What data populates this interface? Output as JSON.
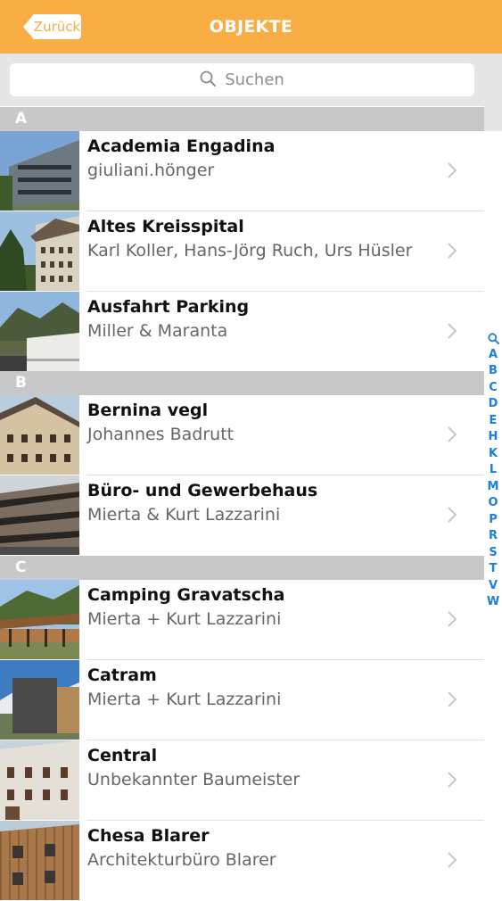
{
  "nav": {
    "back_label": "Zurück",
    "title": "OBJEKTE"
  },
  "search": {
    "placeholder": "Suchen"
  },
  "sections": [
    {
      "letter": "A",
      "items": [
        {
          "title": "Academia Engadina",
          "subtitle": "giuliani.hönger"
        },
        {
          "title": "Altes Kreisspital",
          "subtitle": "Karl Koller, Hans-Jörg Ruch, Urs Hüsler"
        },
        {
          "title": "Ausfahrt Parking",
          "subtitle": "Miller & Maranta"
        }
      ]
    },
    {
      "letter": "B",
      "items": [
        {
          "title": "Bernina vegl",
          "subtitle": "Johannes Badrutt"
        },
        {
          "title": "Büro- und Gewerbehaus",
          "subtitle": "Mierta & Kurt Lazzarini"
        }
      ]
    },
    {
      "letter": "C",
      "items": [
        {
          "title": "Camping Gravatscha",
          "subtitle": "Mierta + Kurt Lazzarini"
        },
        {
          "title": "Catram",
          "subtitle": "Mierta + Kurt Lazzarini"
        },
        {
          "title": "Central",
          "subtitle": "Unbekannter Baumeister"
        },
        {
          "title": "Chesa Blarer",
          "subtitle": "Architekturbüro Blarer"
        }
      ]
    }
  ],
  "index": [
    "A",
    "B",
    "C",
    "D",
    "E",
    "H",
    "K",
    "L",
    "M",
    "O",
    "P",
    "R",
    "S",
    "T",
    "V",
    "W"
  ],
  "colors": {
    "accent": "#f9ad45",
    "index": "#1a7fe0",
    "section_header": "#c8c8c8"
  }
}
